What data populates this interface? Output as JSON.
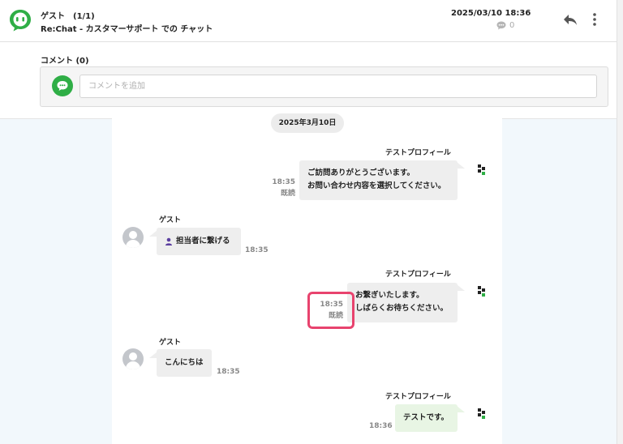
{
  "header": {
    "title": "ゲスト　(1/1)",
    "subtitle": "Re:Chat - カスタマーサポート での チャット",
    "date": "2025/03/10 18:36",
    "comment_count": "0"
  },
  "comment": {
    "label": "コメント (0)",
    "placeholder": "コメントを追加"
  },
  "chat": {
    "date_divider": "2025年3月10日",
    "messages": [
      {
        "sender": "テストプロフィール",
        "line1": "ご訪問ありがとうございます。",
        "line2": "お問い合わせ内容を選択してください。",
        "time": "18:35",
        "status": "既読"
      },
      {
        "sender": "ゲスト",
        "text": "担当者に繋げる",
        "time": "18:35"
      },
      {
        "sender": "テストプロフィール",
        "line1": "お繋ぎいたします。",
        "line2": "しばらくお待ちください。",
        "time": "18:35",
        "status": "既読"
      },
      {
        "sender": "ゲスト",
        "text": "こんにちは",
        "time": "18:35"
      },
      {
        "sender": "テストプロフィール",
        "text": "テストです。",
        "time": "18:36"
      }
    ]
  },
  "colors": {
    "brand_green": "#2fae46",
    "highlight": "#e8436e"
  }
}
